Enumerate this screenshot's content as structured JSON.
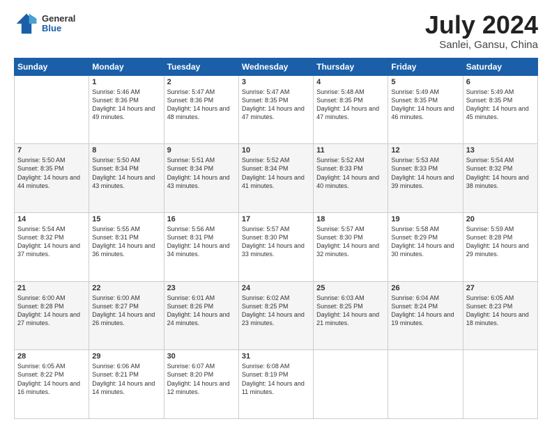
{
  "header": {
    "logo_general": "General",
    "logo_blue": "Blue",
    "month_year": "July 2024",
    "location": "Sanlei, Gansu, China"
  },
  "weekdays": [
    "Sunday",
    "Monday",
    "Tuesday",
    "Wednesday",
    "Thursday",
    "Friday",
    "Saturday"
  ],
  "weeks": [
    [
      {
        "day": "",
        "sunrise": "",
        "sunset": "",
        "daylight": ""
      },
      {
        "day": "1",
        "sunrise": "Sunrise: 5:46 AM",
        "sunset": "Sunset: 8:36 PM",
        "daylight": "Daylight: 14 hours and 49 minutes."
      },
      {
        "day": "2",
        "sunrise": "Sunrise: 5:47 AM",
        "sunset": "Sunset: 8:36 PM",
        "daylight": "Daylight: 14 hours and 48 minutes."
      },
      {
        "day": "3",
        "sunrise": "Sunrise: 5:47 AM",
        "sunset": "Sunset: 8:35 PM",
        "daylight": "Daylight: 14 hours and 47 minutes."
      },
      {
        "day": "4",
        "sunrise": "Sunrise: 5:48 AM",
        "sunset": "Sunset: 8:35 PM",
        "daylight": "Daylight: 14 hours and 47 minutes."
      },
      {
        "day": "5",
        "sunrise": "Sunrise: 5:49 AM",
        "sunset": "Sunset: 8:35 PM",
        "daylight": "Daylight: 14 hours and 46 minutes."
      },
      {
        "day": "6",
        "sunrise": "Sunrise: 5:49 AM",
        "sunset": "Sunset: 8:35 PM",
        "daylight": "Daylight: 14 hours and 45 minutes."
      }
    ],
    [
      {
        "day": "7",
        "sunrise": "Sunrise: 5:50 AM",
        "sunset": "Sunset: 8:35 PM",
        "daylight": "Daylight: 14 hours and 44 minutes."
      },
      {
        "day": "8",
        "sunrise": "Sunrise: 5:50 AM",
        "sunset": "Sunset: 8:34 PM",
        "daylight": "Daylight: 14 hours and 43 minutes."
      },
      {
        "day": "9",
        "sunrise": "Sunrise: 5:51 AM",
        "sunset": "Sunset: 8:34 PM",
        "daylight": "Daylight: 14 hours and 43 minutes."
      },
      {
        "day": "10",
        "sunrise": "Sunrise: 5:52 AM",
        "sunset": "Sunset: 8:34 PM",
        "daylight": "Daylight: 14 hours and 41 minutes."
      },
      {
        "day": "11",
        "sunrise": "Sunrise: 5:52 AM",
        "sunset": "Sunset: 8:33 PM",
        "daylight": "Daylight: 14 hours and 40 minutes."
      },
      {
        "day": "12",
        "sunrise": "Sunrise: 5:53 AM",
        "sunset": "Sunset: 8:33 PM",
        "daylight": "Daylight: 14 hours and 39 minutes."
      },
      {
        "day": "13",
        "sunrise": "Sunrise: 5:54 AM",
        "sunset": "Sunset: 8:32 PM",
        "daylight": "Daylight: 14 hours and 38 minutes."
      }
    ],
    [
      {
        "day": "14",
        "sunrise": "Sunrise: 5:54 AM",
        "sunset": "Sunset: 8:32 PM",
        "daylight": "Daylight: 14 hours and 37 minutes."
      },
      {
        "day": "15",
        "sunrise": "Sunrise: 5:55 AM",
        "sunset": "Sunset: 8:31 PM",
        "daylight": "Daylight: 14 hours and 36 minutes."
      },
      {
        "day": "16",
        "sunrise": "Sunrise: 5:56 AM",
        "sunset": "Sunset: 8:31 PM",
        "daylight": "Daylight: 14 hours and 34 minutes."
      },
      {
        "day": "17",
        "sunrise": "Sunrise: 5:57 AM",
        "sunset": "Sunset: 8:30 PM",
        "daylight": "Daylight: 14 hours and 33 minutes."
      },
      {
        "day": "18",
        "sunrise": "Sunrise: 5:57 AM",
        "sunset": "Sunset: 8:30 PM",
        "daylight": "Daylight: 14 hours and 32 minutes."
      },
      {
        "day": "19",
        "sunrise": "Sunrise: 5:58 AM",
        "sunset": "Sunset: 8:29 PM",
        "daylight": "Daylight: 14 hours and 30 minutes."
      },
      {
        "day": "20",
        "sunrise": "Sunrise: 5:59 AM",
        "sunset": "Sunset: 8:28 PM",
        "daylight": "Daylight: 14 hours and 29 minutes."
      }
    ],
    [
      {
        "day": "21",
        "sunrise": "Sunrise: 6:00 AM",
        "sunset": "Sunset: 8:28 PM",
        "daylight": "Daylight: 14 hours and 27 minutes."
      },
      {
        "day": "22",
        "sunrise": "Sunrise: 6:00 AM",
        "sunset": "Sunset: 8:27 PM",
        "daylight": "Daylight: 14 hours and 26 minutes."
      },
      {
        "day": "23",
        "sunrise": "Sunrise: 6:01 AM",
        "sunset": "Sunset: 8:26 PM",
        "daylight": "Daylight: 14 hours and 24 minutes."
      },
      {
        "day": "24",
        "sunrise": "Sunrise: 6:02 AM",
        "sunset": "Sunset: 8:25 PM",
        "daylight": "Daylight: 14 hours and 23 minutes."
      },
      {
        "day": "25",
        "sunrise": "Sunrise: 6:03 AM",
        "sunset": "Sunset: 8:25 PM",
        "daylight": "Daylight: 14 hours and 21 minutes."
      },
      {
        "day": "26",
        "sunrise": "Sunrise: 6:04 AM",
        "sunset": "Sunset: 8:24 PM",
        "daylight": "Daylight: 14 hours and 19 minutes."
      },
      {
        "day": "27",
        "sunrise": "Sunrise: 6:05 AM",
        "sunset": "Sunset: 8:23 PM",
        "daylight": "Daylight: 14 hours and 18 minutes."
      }
    ],
    [
      {
        "day": "28",
        "sunrise": "Sunrise: 6:05 AM",
        "sunset": "Sunset: 8:22 PM",
        "daylight": "Daylight: 14 hours and 16 minutes."
      },
      {
        "day": "29",
        "sunrise": "Sunrise: 6:06 AM",
        "sunset": "Sunset: 8:21 PM",
        "daylight": "Daylight: 14 hours and 14 minutes."
      },
      {
        "day": "30",
        "sunrise": "Sunrise: 6:07 AM",
        "sunset": "Sunset: 8:20 PM",
        "daylight": "Daylight: 14 hours and 12 minutes."
      },
      {
        "day": "31",
        "sunrise": "Sunrise: 6:08 AM",
        "sunset": "Sunset: 8:19 PM",
        "daylight": "Daylight: 14 hours and 11 minutes."
      },
      {
        "day": "",
        "sunrise": "",
        "sunset": "",
        "daylight": ""
      },
      {
        "day": "",
        "sunrise": "",
        "sunset": "",
        "daylight": ""
      },
      {
        "day": "",
        "sunrise": "",
        "sunset": "",
        "daylight": ""
      }
    ]
  ]
}
